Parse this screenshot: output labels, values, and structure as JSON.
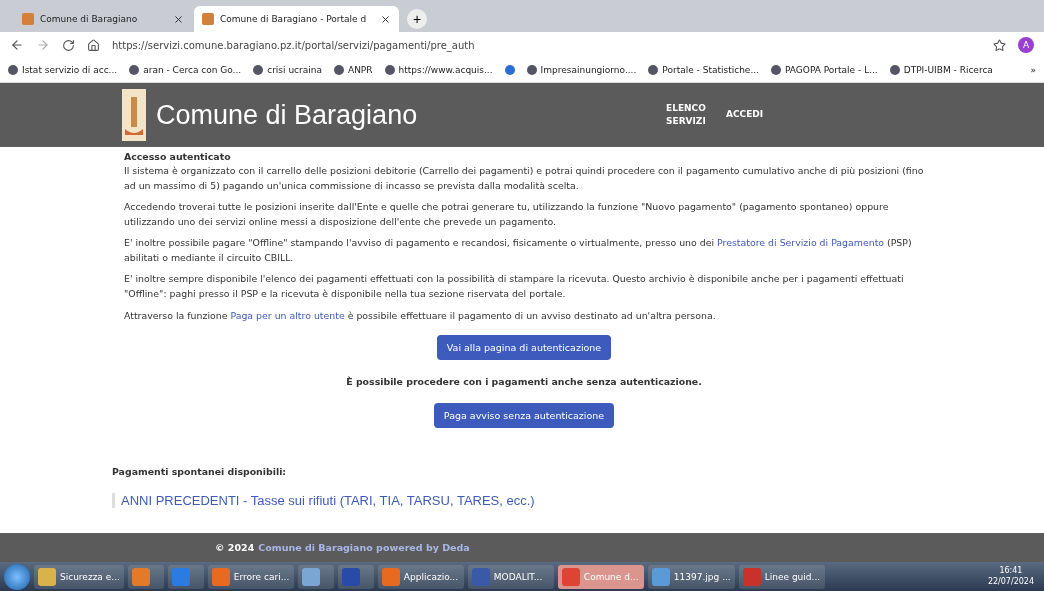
{
  "browser": {
    "tabs": [
      {
        "label": "Comune di Baragiano",
        "selected": false
      },
      {
        "label": "Comune di Baragiano - Portale d",
        "selected": true
      }
    ],
    "new_tab": "+",
    "address": "https://servizi.comune.baragiano.pz.it/portal/servizi/pagamenti/pre_auth",
    "profile": "A",
    "bookmarks": [
      {
        "label": "Istat servizio di acc..."
      },
      {
        "label": "aran - Cerca con Go..."
      },
      {
        "label": "crisi ucraina"
      },
      {
        "label": "ANPR"
      },
      {
        "label": "https://www.acquis..."
      },
      {
        "kind": "icon"
      },
      {
        "label": "Impresainungiorno...."
      },
      {
        "label": "Portale - Statistiche..."
      },
      {
        "label": "PAGOPA Portale - L..."
      },
      {
        "label": "DTPI-UIBM - Ricerca"
      }
    ],
    "more": "»"
  },
  "header": {
    "title": "Comune di Baragiano",
    "nav": [
      "ELENCO SERVIZI",
      "ACCEDI"
    ]
  },
  "content": {
    "heading": "Accesso autenticato",
    "paragraphs": [
      "Il sistema è organizzato con il carrello delle posizioni debitorie (Carrello dei pagamenti) e potrai quindi procedere con il pagamento cumulativo anche di più posizioni (fino ad un massimo di 5) pagando un'unica commissione di incasso se prevista dalla modalità scelta.",
      "Accedendo troverai tutte le posizioni inserite dall'Ente e quelle che potrai generare tu, utilizzando la funzione \"Nuovo pagamento\" (pagamento spontaneo) oppure utilizzando uno dei servizi online messi a disposizione dell'ente che prevede un pagamento.",
      {
        "text": "E' inoltre possibile pagare \"Offline\" stampando l'avviso di pagamento e recandosi, fisicamente o virtualmente, presso uno dei ",
        "link": "Prestatore di Servizio di Pagamento",
        "after": " (PSP) abilitati o mediante il circuito CBILL."
      },
      "E' inoltre sempre disponibile l'elenco dei pagamenti effettuati con la possibilità di stampare la ricevuta. Questo archivio è disponibile anche per i pagamenti effettuati \"Offline\": paghi presso il PSP e la ricevuta è disponibile nella tua sezione riservata del portale.",
      {
        "text": "Attraverso la funzione ",
        "link": "Paga per un altro utente",
        "after": " è possibile effettuare il pagamento di un avviso destinato ad un'altra persona."
      }
    ],
    "auth_button": "Vai alla pagina di autenticazione",
    "note": "È possibile procedere con i pagamenti anche senza autenticazione.",
    "guest_button": "Paga avviso senza autenticazione",
    "spontaneous_heading": "Pagamenti spontanei disponibili:",
    "spontaneous_items": [
      "ANNI PRECEDENTI - Tasse sui rifiuti (TARI, TIA, TARSU, TARES, ecc.)"
    ]
  },
  "footer": {
    "copyright": "© 2024",
    "link": "Comune di Baragiano powered by Deda"
  },
  "taskbar": {
    "items": [
      {
        "label": "Sicurezza e...",
        "selected": false
      },
      {
        "selected": false
      },
      {
        "selected": false
      },
      {
        "label": "Errore cari...",
        "selected": false
      },
      {
        "selected": false
      },
      {
        "selected": false
      },
      {
        "label": "Applicazio...",
        "selected": false
      },
      {
        "label": "MODALIT...",
        "selected": false
      },
      {
        "label": "Comune d...",
        "selected": true
      },
      {
        "label": "11397.jpg ...",
        "selected": false
      },
      {
        "label": "Linee guid...",
        "selected": false
      }
    ],
    "time": "16:41",
    "date": "22/07/2024"
  }
}
